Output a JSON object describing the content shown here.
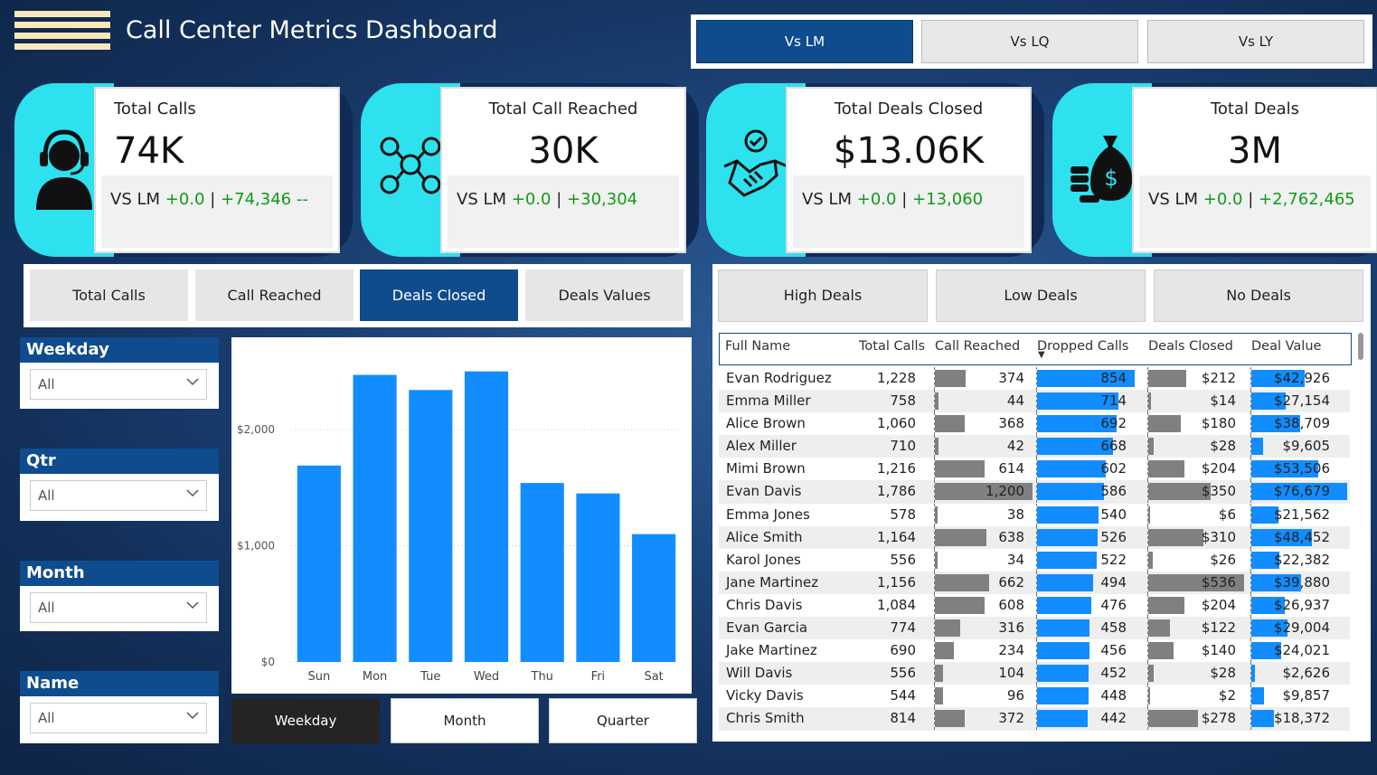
{
  "header": {
    "title": "Call Center Metrics Dashboard"
  },
  "compare": {
    "buttons": [
      "Vs LM",
      "Vs LQ",
      "Vs LY"
    ],
    "active": 0
  },
  "kpis": [
    {
      "label": "Total Calls",
      "value": "74K",
      "cmp_prefix": "VS LM",
      "cmp_delta": "+0.0",
      "cmp_sep": "|",
      "cmp_abs": "+74,346",
      "cmp_tail": "--",
      "icon": "headset-agent-icon"
    },
    {
      "label": "Total Call Reached",
      "value": "30K",
      "cmp_prefix": "VS LM",
      "cmp_delta": "+0.0",
      "cmp_sep": "|",
      "cmp_abs": "+30,304",
      "cmp_tail": "",
      "icon": "network-people-icon"
    },
    {
      "label": "Total Deals Closed",
      "value": "$13.06K",
      "cmp_prefix": "VS LM",
      "cmp_delta": "+0.0",
      "cmp_sep": "|",
      "cmp_abs": "+13,060",
      "cmp_tail": "",
      "icon": "handshake-icon"
    },
    {
      "label": "Total Deals",
      "value": "3M",
      "cmp_prefix": "VS LM",
      "cmp_delta": "+0.0",
      "cmp_sep": "|",
      "cmp_abs": "+2,762,465",
      "cmp_tail": "",
      "icon": "money-bag-icon"
    }
  ],
  "metrics": {
    "buttons": [
      "Total Calls",
      "Call Reached",
      "Deals Closed",
      "Deals Values"
    ],
    "active": 2
  },
  "slicers": [
    {
      "label": "Weekday",
      "value": "All"
    },
    {
      "label": "Qtr",
      "value": "All"
    },
    {
      "label": "Month",
      "value": "All"
    },
    {
      "label": "Name",
      "value": "All"
    }
  ],
  "chart_data": {
    "type": "bar",
    "categories": [
      "Sun",
      "Mon",
      "Tue",
      "Wed",
      "Thu",
      "Fri",
      "Sat"
    ],
    "values": [
      1690,
      2470,
      2340,
      2500,
      1540,
      1450,
      1100
    ],
    "yticks": [
      "$0",
      "$1,000",
      "$2,000"
    ],
    "ytick_values": [
      0,
      1000,
      2000
    ],
    "ylim": [
      0,
      2700
    ],
    "color": "#118dff"
  },
  "xaxis_buttons": {
    "labels": [
      "Weekday",
      "Month",
      "Quarter"
    ],
    "active": 0
  },
  "deal_filters": [
    "High Deals",
    "Low Deals",
    "No Deals"
  ],
  "table": {
    "columns": [
      "Full Name",
      "Total Calls",
      "Call Reached",
      "Dropped Calls",
      "Deals Closed",
      "Deal Value"
    ],
    "sort_indicator": "▼",
    "max": {
      "reached": 1200,
      "dropped": 854,
      "closed": 536,
      "value": 76679
    },
    "rows": [
      {
        "name": "Evan Rodriguez",
        "calls": "1,228",
        "reached": "374",
        "reached_n": 374,
        "dropped": "854",
        "dropped_n": 854,
        "closed": "$212",
        "closed_n": 212,
        "value": "$42,926",
        "value_n": 42926
      },
      {
        "name": "Emma Miller",
        "calls": "758",
        "reached": "44",
        "reached_n": 44,
        "dropped": "714",
        "dropped_n": 714,
        "closed": "$14",
        "closed_n": 14,
        "value": "$27,154",
        "value_n": 27154
      },
      {
        "name": "Alice Brown",
        "calls": "1,060",
        "reached": "368",
        "reached_n": 368,
        "dropped": "692",
        "dropped_n": 692,
        "closed": "$180",
        "closed_n": 180,
        "value": "$38,709",
        "value_n": 38709
      },
      {
        "name": "Alex Miller",
        "calls": "710",
        "reached": "42",
        "reached_n": 42,
        "dropped": "668",
        "dropped_n": 668,
        "closed": "$28",
        "closed_n": 28,
        "value": "$9,605",
        "value_n": 9605
      },
      {
        "name": "Mimi Brown",
        "calls": "1,216",
        "reached": "614",
        "reached_n": 614,
        "dropped": "602",
        "dropped_n": 602,
        "closed": "$204",
        "closed_n": 204,
        "value": "$53,506",
        "value_n": 53506
      },
      {
        "name": "Evan Davis",
        "calls": "1,786",
        "reached": "1,200",
        "reached_n": 1200,
        "dropped": "586",
        "dropped_n": 586,
        "closed": "$350",
        "closed_n": 350,
        "value": "$76,679",
        "value_n": 76679
      },
      {
        "name": "Emma Jones",
        "calls": "578",
        "reached": "38",
        "reached_n": 38,
        "dropped": "540",
        "dropped_n": 540,
        "closed": "$6",
        "closed_n": 6,
        "value": "$21,562",
        "value_n": 21562
      },
      {
        "name": "Alice Smith",
        "calls": "1,164",
        "reached": "638",
        "reached_n": 638,
        "dropped": "526",
        "dropped_n": 526,
        "closed": "$310",
        "closed_n": 310,
        "value": "$48,452",
        "value_n": 48452
      },
      {
        "name": "Karol Jones",
        "calls": "556",
        "reached": "34",
        "reached_n": 34,
        "dropped": "522",
        "dropped_n": 522,
        "closed": "$26",
        "closed_n": 26,
        "value": "$22,382",
        "value_n": 22382
      },
      {
        "name": "Jane Martinez",
        "calls": "1,156",
        "reached": "662",
        "reached_n": 662,
        "dropped": "494",
        "dropped_n": 494,
        "closed": "$536",
        "closed_n": 536,
        "value": "$39,880",
        "value_n": 39880
      },
      {
        "name": "Chris Davis",
        "calls": "1,084",
        "reached": "608",
        "reached_n": 608,
        "dropped": "476",
        "dropped_n": 476,
        "closed": "$204",
        "closed_n": 204,
        "value": "$26,937",
        "value_n": 26937
      },
      {
        "name": "Evan Garcia",
        "calls": "774",
        "reached": "316",
        "reached_n": 316,
        "dropped": "458",
        "dropped_n": 458,
        "closed": "$122",
        "closed_n": 122,
        "value": "$29,004",
        "value_n": 29004
      },
      {
        "name": "Jake Martinez",
        "calls": "690",
        "reached": "234",
        "reached_n": 234,
        "dropped": "456",
        "dropped_n": 456,
        "closed": "$140",
        "closed_n": 140,
        "value": "$24,021",
        "value_n": 24021
      },
      {
        "name": "Will Davis",
        "calls": "556",
        "reached": "104",
        "reached_n": 104,
        "dropped": "452",
        "dropped_n": 452,
        "closed": "$28",
        "closed_n": 28,
        "value": "$2,626",
        "value_n": 2626
      },
      {
        "name": "Vicky Davis",
        "calls": "544",
        "reached": "96",
        "reached_n": 96,
        "dropped": "448",
        "dropped_n": 448,
        "closed": "$2",
        "closed_n": 2,
        "value": "$9,857",
        "value_n": 9857
      },
      {
        "name": "Chris Smith",
        "calls": "814",
        "reached": "372",
        "reached_n": 372,
        "dropped": "442",
        "dropped_n": 442,
        "closed": "$278",
        "closed_n": 278,
        "value": "$18,372",
        "value_n": 18372
      }
    ]
  },
  "colors": {
    "accent": "#0f4c8e",
    "cyan": "#2de1ef",
    "bar_blue": "#118dff",
    "bar_gray": "#808080",
    "green": "#119a19"
  }
}
